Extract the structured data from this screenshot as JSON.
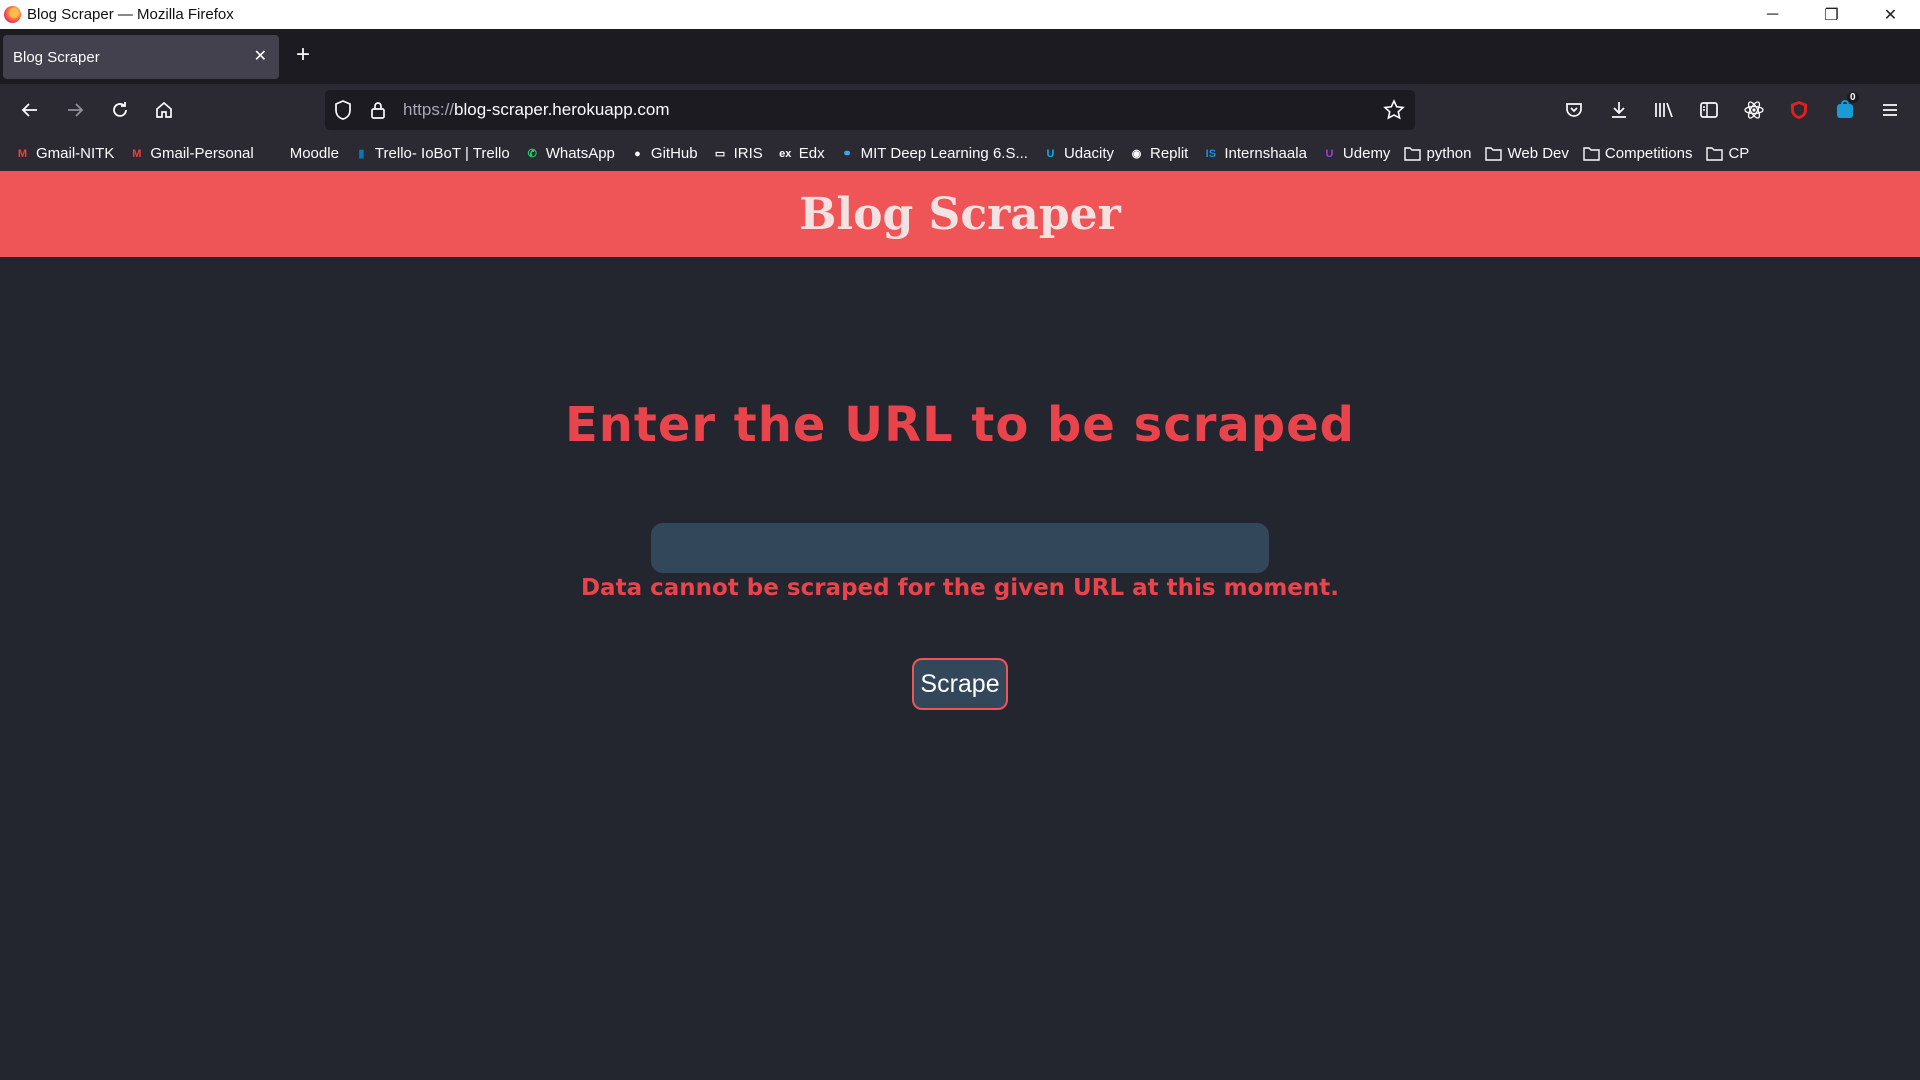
{
  "window": {
    "title": "Blog Scraper — Mozilla Firefox",
    "minimize": "─",
    "restore": "❐",
    "close": "✕"
  },
  "tabs": [
    {
      "label": "Blog Scraper",
      "close": "✕"
    }
  ],
  "new_tab_label": "+",
  "address_bar": {
    "protocol": "https://",
    "host": "blog-scraper.herokuapp.com"
  },
  "toolbar": {
    "notification_count": "0"
  },
  "bookmarks": [
    {
      "label": "Gmail-NITK",
      "icon": "M",
      "icon_color": "#ea4335",
      "icon_name": "gmail-icon"
    },
    {
      "label": "Gmail-Personal",
      "icon": "M",
      "icon_color": "#ea4335",
      "icon_name": "gmail-icon"
    },
    {
      "label": "Moodle",
      "icon": "",
      "icon_color": "#2b2a33",
      "icon_name": "moodle-icon"
    },
    {
      "label": "Trello- IoBoT | Trello",
      "icon": "▮",
      "icon_color": "#0079bf",
      "icon_name": "trello-icon"
    },
    {
      "label": "WhatsApp",
      "icon": "✆",
      "icon_color": "#25d366",
      "icon_name": "whatsapp-icon"
    },
    {
      "label": "GitHub",
      "icon": "●",
      "icon_color": "#fbfbfe",
      "icon_name": "github-icon"
    },
    {
      "label": "IRIS",
      "icon": "▭",
      "icon_color": "#ffffff",
      "icon_name": "iris-icon"
    },
    {
      "label": "Edx",
      "icon": "ex",
      "icon_color": "#fbfbfe",
      "icon_name": "edx-icon"
    },
    {
      "label": "MIT Deep Learning 6.S...",
      "icon": "⚭",
      "icon_color": "#3fa9f5",
      "icon_name": "mit-icon"
    },
    {
      "label": "Udacity",
      "icon": "U",
      "icon_color": "#02b3e4",
      "icon_name": "udacity-icon"
    },
    {
      "label": "Replit",
      "icon": "◉",
      "icon_color": "#fbfbfe",
      "icon_name": "replit-icon"
    },
    {
      "label": "Internshaala",
      "icon": "IS",
      "icon_color": "#1295d8",
      "icon_name": "internshaala-icon"
    },
    {
      "label": "Udemy",
      "icon": "U",
      "icon_color": "#a435f0",
      "icon_name": "udemy-icon"
    },
    {
      "label": "python",
      "icon": "",
      "icon_color": "#fbfbfe",
      "icon_name": "folder-icon"
    },
    {
      "label": "Web Dev",
      "icon": "",
      "icon_color": "#fbfbfe",
      "icon_name": "folder-icon"
    },
    {
      "label": "Competitions",
      "icon": "",
      "icon_color": "#fbfbfe",
      "icon_name": "folder-icon"
    },
    {
      "label": "CP",
      "icon": "",
      "icon_color": "#fbfbfe",
      "icon_name": "folder-icon"
    }
  ],
  "page": {
    "header_title": "Blog Scraper",
    "heading": "Enter the URL to be scraped",
    "url_input_value": "",
    "url_input_placeholder": "",
    "error_message": "Data cannot be scraped for the given URL at this moment.",
    "scrape_button": "Scrape"
  },
  "colors": {
    "header_bg": "#ef5456",
    "accent_red": "#e9444c",
    "page_bg": "#23262f",
    "input_bg": "#33475b"
  }
}
